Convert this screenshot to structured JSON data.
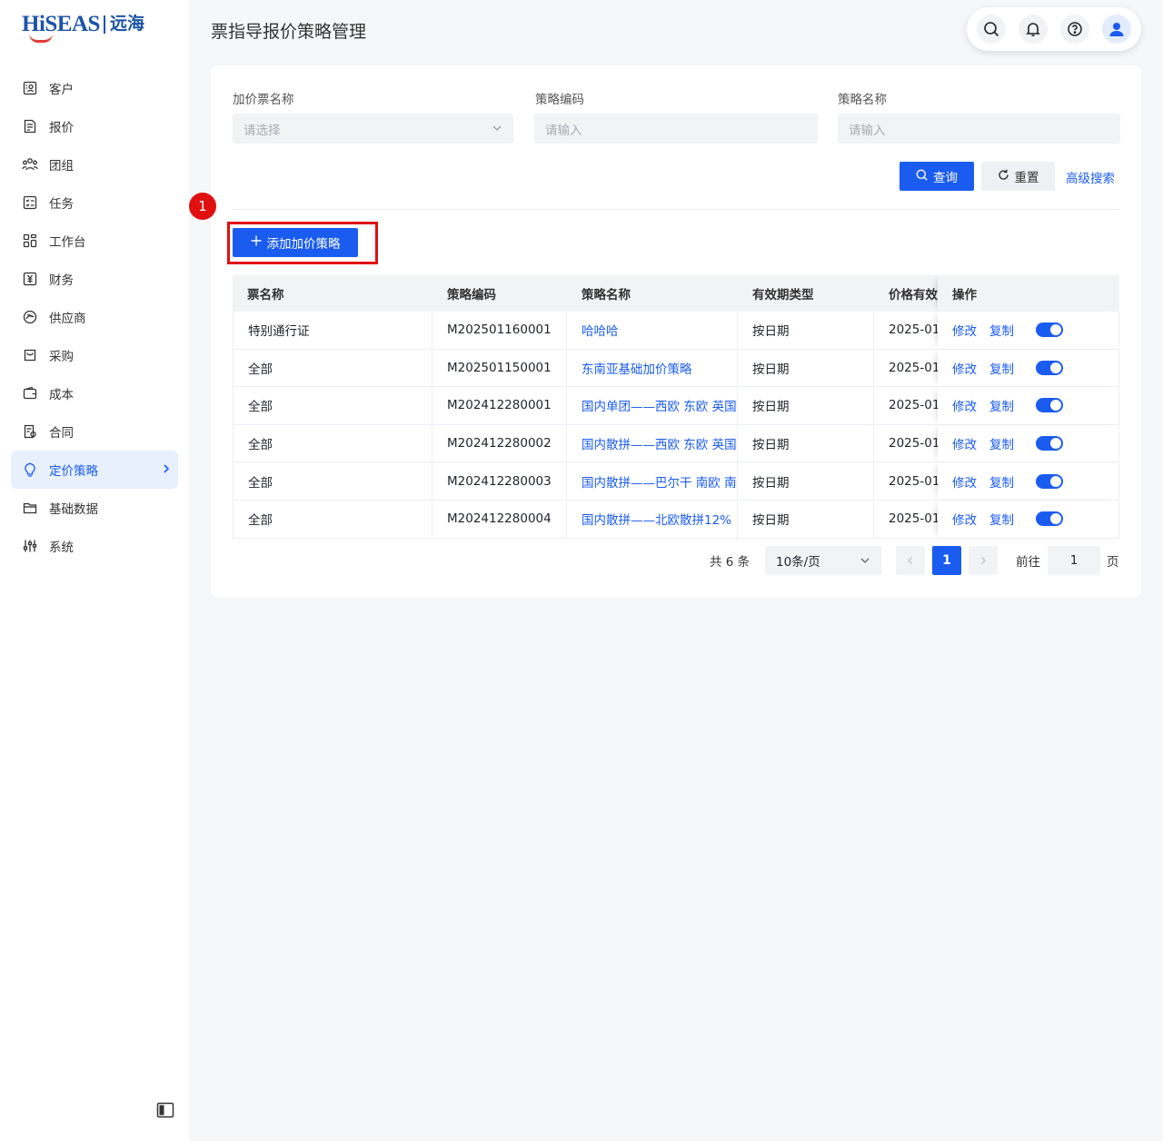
{
  "logo": {
    "main": "HiSEAS",
    "cn": "远海"
  },
  "sidebar": {
    "items": [
      {
        "label": "客户",
        "icon": "customer-icon"
      },
      {
        "label": "报价",
        "icon": "quote-icon"
      },
      {
        "label": "团组",
        "icon": "group-icon"
      },
      {
        "label": "任务",
        "icon": "task-icon"
      },
      {
        "label": "工作台",
        "icon": "workbench-icon"
      },
      {
        "label": "财务",
        "icon": "finance-icon"
      },
      {
        "label": "供应商",
        "icon": "supplier-icon"
      },
      {
        "label": "采购",
        "icon": "purchase-icon"
      },
      {
        "label": "成本",
        "icon": "cost-icon"
      },
      {
        "label": "合同",
        "icon": "contract-icon"
      },
      {
        "label": "定价策略",
        "icon": "bulb-icon",
        "active": true
      },
      {
        "label": "基础数据",
        "icon": "folder-icon"
      },
      {
        "label": "系统",
        "icon": "sliders-icon"
      }
    ]
  },
  "header": {
    "title": "票指导报价策略管理"
  },
  "filters": {
    "ticket_name": {
      "label": "加价票名称",
      "placeholder": "请选择"
    },
    "strategy_code": {
      "label": "策略编码",
      "placeholder": "请输入"
    },
    "strategy_name": {
      "label": "策略名称",
      "placeholder": "请输入"
    }
  },
  "buttons": {
    "query": "查询",
    "reset": "重置",
    "advanced": "高级搜索",
    "add": "添加加价策略"
  },
  "step_badge": "1",
  "table": {
    "headers": [
      "票名称",
      "策略编码",
      "策略名称",
      "有效期类型",
      "价格有效",
      "操作"
    ],
    "rows": [
      {
        "ticket": "特别通行证",
        "code": "M202501160001",
        "name": "哈哈哈",
        "validity": "按日期",
        "price_valid": "2025-01"
      },
      {
        "ticket": "全部",
        "code": "M202501150001",
        "name": "东南亚基础加价策略",
        "validity": "按日期",
        "price_valid": "2025-01"
      },
      {
        "ticket": "全部",
        "code": "M202412280001",
        "name": "国内单团——西欧 东欧 英国",
        "validity": "按日期",
        "price_valid": "2025-01"
      },
      {
        "ticket": "全部",
        "code": "M202412280002",
        "name": "国内散拼——西欧 东欧 英国",
        "validity": "按日期",
        "price_valid": "2025-01"
      },
      {
        "ticket": "全部",
        "code": "M202412280003",
        "name": "国内散拼——巴尔干 南欧 南",
        "validity": "按日期",
        "price_valid": "2025-01"
      },
      {
        "ticket": "全部",
        "code": "M202412280004",
        "name": "国内散拼——北欧散拼12%",
        "validity": "按日期",
        "price_valid": "2025-01"
      }
    ],
    "op_edit": "修改",
    "op_copy": "复制"
  },
  "pagination": {
    "total": "共 6 条",
    "page_size": "10条/页",
    "current": "1",
    "goto_label": "前往",
    "goto_value": "1",
    "page_suffix": "页"
  }
}
